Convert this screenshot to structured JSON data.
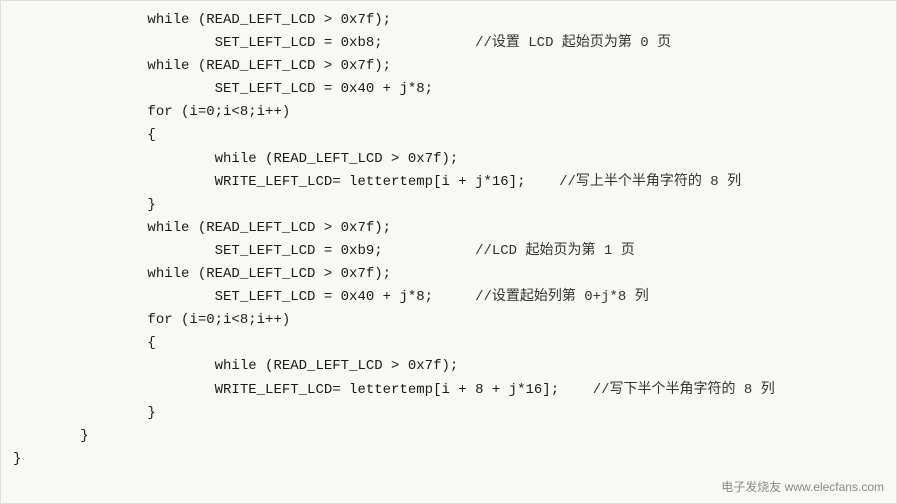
{
  "code": {
    "lines": [
      {
        "indent": 2,
        "text": "while (READ_LEFT_LCD > 0x7f);",
        "comment": ""
      },
      {
        "indent": 3,
        "text": "SET_LEFT_LCD = 0xb8;",
        "comment": "//设置 LCD 起始页为第 0 页"
      },
      {
        "indent": 2,
        "text": "while (READ_LEFT_LCD > 0x7f);",
        "comment": ""
      },
      {
        "indent": 3,
        "text": "SET_LEFT_LCD = 0x40 + j*8;",
        "comment": ""
      },
      {
        "indent": 2,
        "text": "for (i=0;i<8;i++)",
        "comment": ""
      },
      {
        "indent": 2,
        "text": "{",
        "comment": ""
      },
      {
        "indent": 3,
        "text": "while (READ_LEFT_LCD > 0x7f);",
        "comment": ""
      },
      {
        "indent": 3,
        "text": "WRITE_LEFT_LCD= lettertemp[i + j*16];",
        "comment": "//写上半个半角字符的 8 列"
      },
      {
        "indent": 2,
        "text": "}",
        "comment": ""
      },
      {
        "indent": 2,
        "text": "while (READ_LEFT_LCD > 0x7f);",
        "comment": ""
      },
      {
        "indent": 3,
        "text": "SET_LEFT_LCD = 0xb9;",
        "comment": "//LCD 起始页为第 1 页"
      },
      {
        "indent": 2,
        "text": "while (READ_LEFT_LCD > 0x7f);",
        "comment": ""
      },
      {
        "indent": 3,
        "text": "SET_LEFT_LCD = 0x40 + j*8;",
        "comment": "//设置起始列第 0+j*8 列"
      },
      {
        "indent": 2,
        "text": "for (i=0;i<8;i++)",
        "comment": ""
      },
      {
        "indent": 2,
        "text": "{",
        "comment": ""
      },
      {
        "indent": 3,
        "text": "while (READ_LEFT_LCD > 0x7f);",
        "comment": ""
      },
      {
        "indent": 3,
        "text": "WRITE_LEFT_LCD= lettertemp[i + 8 + j*16];",
        "comment": "//写下半个半角字符的 8 列"
      },
      {
        "indent": 2,
        "text": "}",
        "comment": ""
      },
      {
        "indent": 1,
        "text": "}",
        "comment": ""
      },
      {
        "indent": 0,
        "text": "}",
        "comment": ""
      }
    ]
  },
  "watermark": {
    "text": "电子发烧友 www.elecfans.com"
  }
}
